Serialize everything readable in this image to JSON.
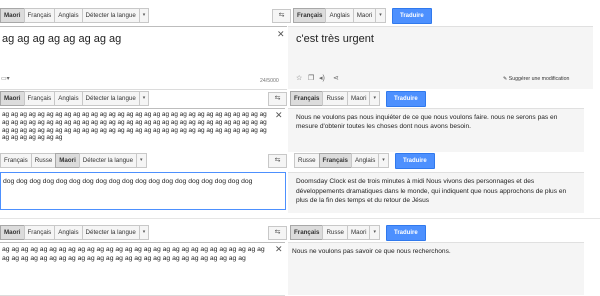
{
  "rows": [
    {
      "src_tabs": [
        "Maori",
        "Français",
        "Anglais",
        "Détecter la langue"
      ],
      "dst_tabs": [
        "Français",
        "Anglais",
        "Maori"
      ],
      "translate": "Traduire",
      "source_text": "ag ag ag ag ag ag ag ag",
      "output_text": "c'est très urgent",
      "char_count": "24/5000",
      "suggest": "Suggérer une modification"
    },
    {
      "src_tabs": [
        "Maori",
        "Français",
        "Anglais",
        "Détecter la langue"
      ],
      "dst_tabs": [
        "Français",
        "Russe",
        "Maori"
      ],
      "translate": "Traduire",
      "source_text": "ag ag ag ag ag ag ag ag ag ag ag ag ag ag ag ag ag ag ag ag ag ag ag ag ag ag ag ag ag ag ag ag ag ag ag ag ag ag ag ag ag ag ag ag ag ag ag ag ag ag  ag  ag ag ag ag ag ag ag ag ag ag ag ag ag ag ag ag ag ag ag ag ag ag ag ag ag ag ag ag ag ag ag ag ag ag ag ag ag ag ag ag ag ag ag ag ag ag",
      "output_text": "Nous ne voulons pas nous inquiéter de ce que nous voulons faire. nous ne serons pas en mesure d'obtenir toutes les choses dont nous avons besoin."
    },
    {
      "src_tabs": [
        "Français",
        "Russe",
        "Maori",
        "Détecter la langue"
      ],
      "dst_tabs": [
        "Russe",
        "Français",
        "Anglais"
      ],
      "translate": "Traduire",
      "source_text": "dog dog dog dog dog dog dog dog dog dog dog dog dog dog dog dog dog dog dog",
      "output_text": "Doomsday Clock est de trois minutes à midi Nous vivons des personnages et des développements dramatiques dans le monde, qui indiquent que nous approchons de plus en plus de la fin des temps et du retour de Jésus"
    },
    {
      "src_tabs": [
        "Maori",
        "Français",
        "Anglais",
        "Détecter la langue"
      ],
      "dst_tabs": [
        "Français",
        "Russe",
        "Maori"
      ],
      "translate": "Traduire",
      "source_text": "ag ag ag ag ag ag ag ag ag ag ag ag ag ag ag ag ag ag ag ag ag ag ag ag ag ag ag ag ag ag ag ag ag ag ag ag ag ag ag ag ag ag ag ag ag ag ag ag ag ag ag ag  ag  ag",
      "output_text": "Nous ne voulons pas savoir ce que nous recherchons."
    }
  ]
}
